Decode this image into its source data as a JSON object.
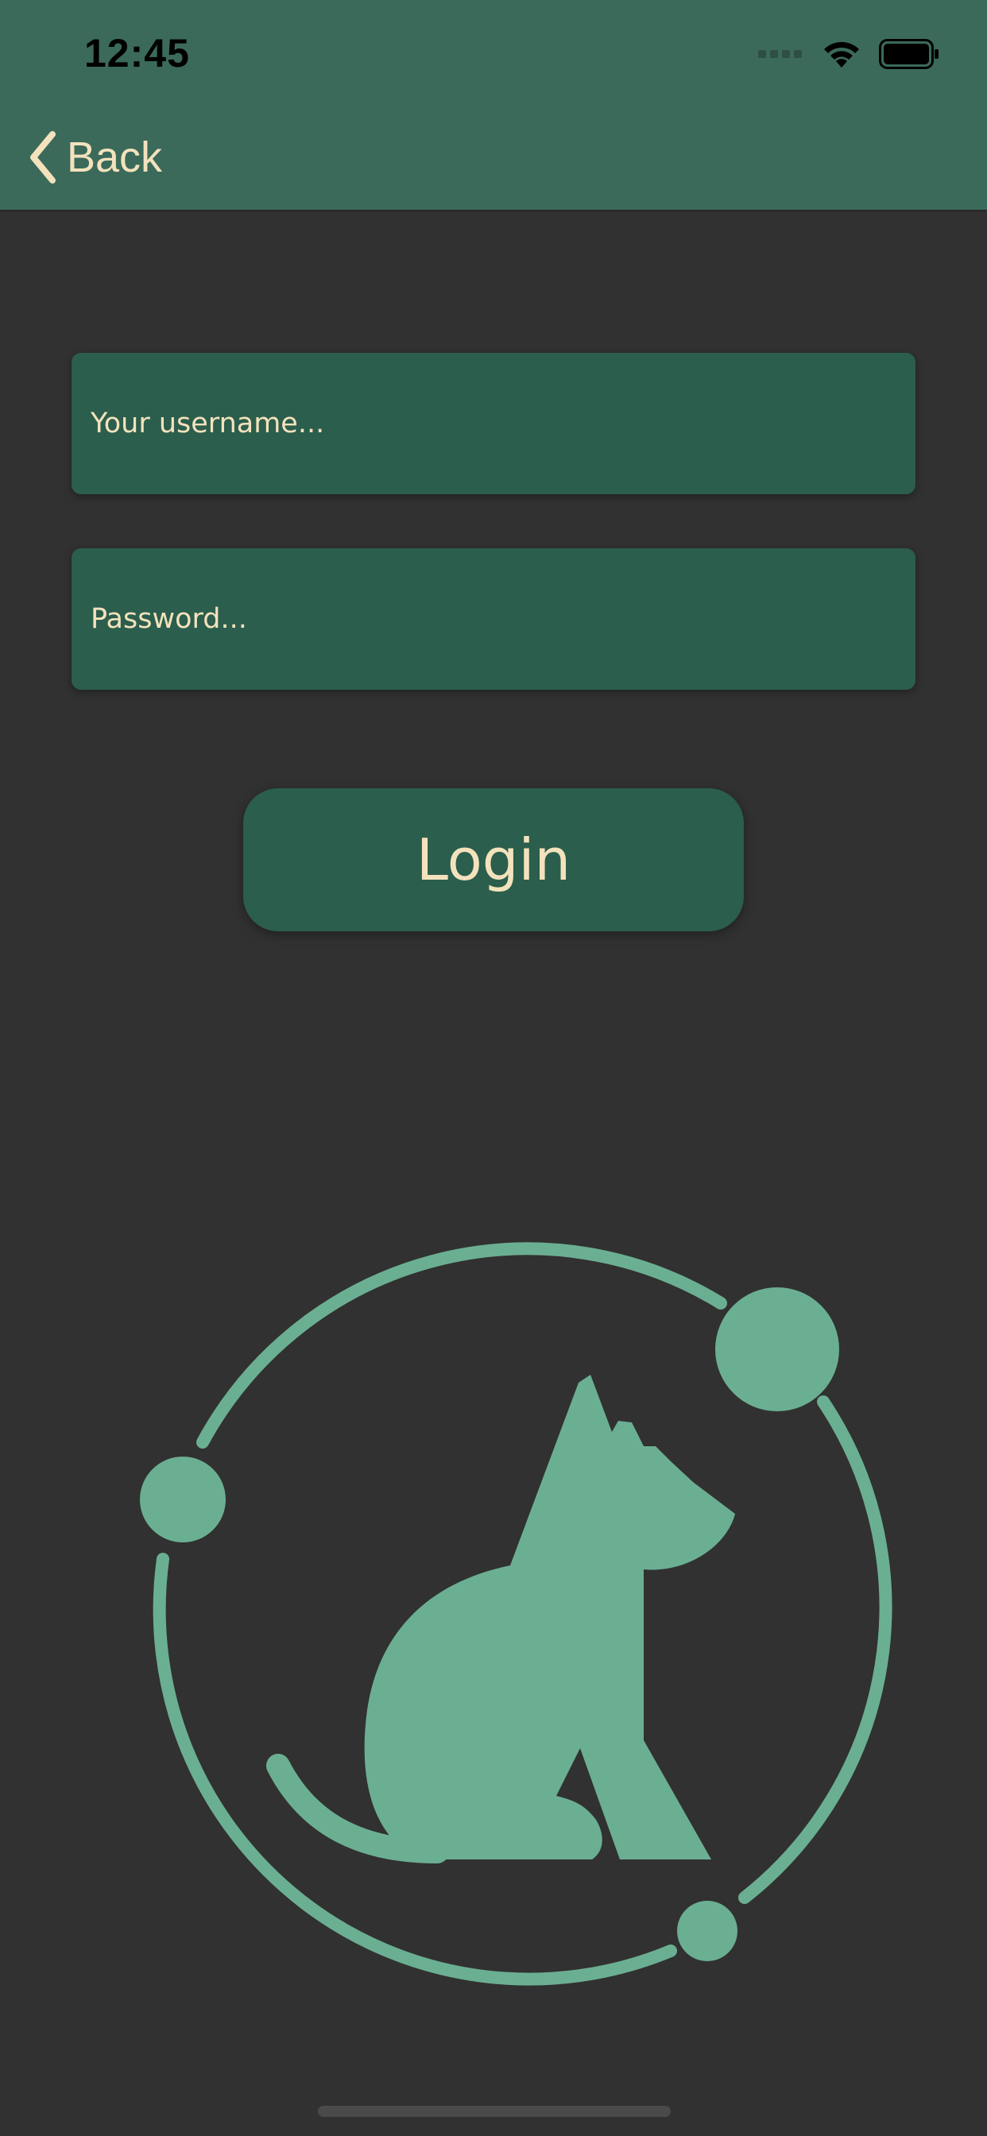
{
  "status_bar": {
    "time": "12:45"
  },
  "nav": {
    "back_label": "Back"
  },
  "form": {
    "username_placeholder": "Your username...",
    "password_placeholder": "Password...",
    "login_label": "Login"
  },
  "colors": {
    "header": "#3b6a5a",
    "background": "#313131",
    "field": "#2b5e4c",
    "text": "#f3e2bd",
    "logo": "#6baf92"
  },
  "icons": {
    "back": "chevron-left-icon",
    "wifi": "wifi-icon",
    "battery": "battery-icon",
    "signal": "cellular-signal-icon",
    "logo": "dog-orbit-logo-icon"
  }
}
